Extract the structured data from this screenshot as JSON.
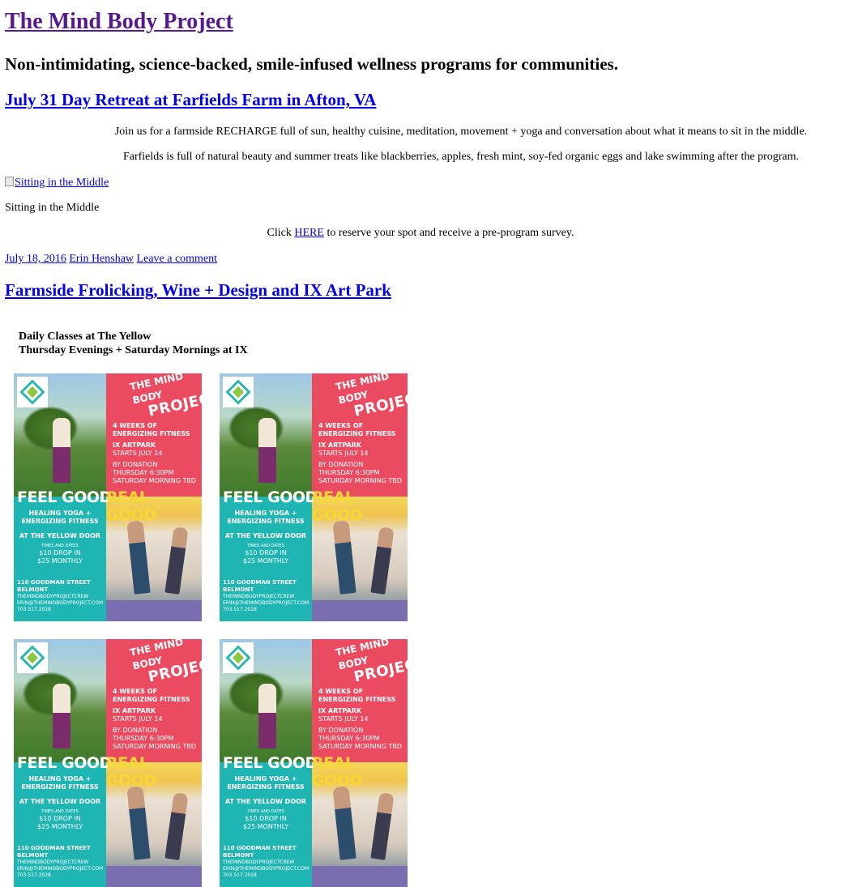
{
  "site": {
    "title": "The Mind Body Project",
    "tagline": "Non-intimidating, science-backed, smile-infused wellness programs for communities."
  },
  "post1": {
    "title": "July 31 Day Retreat at Farfields Farm in Afton, VA",
    "para1": "Join us for a farmside RECHARGE full of sun, healthy cuisine, meditation, movement + yoga and conversation about what it means to sit in the middle.",
    "para2": "Farfields is full of natural beauty and summer treats like blackberries, apples, fresh mint, soy-fed organic eggs and lake swimming after the program.",
    "image_alt": "Sitting in the Middle",
    "caption": "Sitting in the Middle",
    "click_prefix": "Click ",
    "click_link": "HERE",
    "click_suffix": " to reserve your spot and receive a pre-program survey.",
    "meta": {
      "date": "July 18, 2016",
      "author": "Erin Henshaw",
      "comment": "Leave a comment"
    }
  },
  "post2": {
    "title": "Farmside Frolicking, Wine + Design and IX Art Park",
    "classes_line1": "Daily Classes at The Yellow",
    "classes_line2": "Thursday Evenings + Saturday Mornings at IX"
  },
  "flyer": {
    "brand_small": "THE MIND BODY",
    "brand_big": "PROJECT",
    "weeks": "4 WEEKS OF",
    "fitness": "ENERGIZING FITNESS",
    "venue": "IX ARTPARK",
    "starts": "STARTS JULY 14",
    "donation": "BY DONATION",
    "thursday": "THURSDAY 6:30PM",
    "saturday": "SATURDAY MORNING TBD",
    "feel_good": "FEEL GOOD",
    "real_good": "REAL GOOD",
    "healing1": "HEALING YOGA +",
    "healing2": "ENERGIZING FITNESS",
    "yellow_door": "AT THE YELLOW DOOR",
    "times": "TIMES AND DATES",
    "drop_in": "$10 DROP IN",
    "monthly": "$25 MONTHLY",
    "street": "110 GOODMAN STREET",
    "city": "BELMONT",
    "social": "THEMINDBODYPROJECTCREW",
    "email": "ERIN@THEMINDBODYPROJECT.COM",
    "phone": "703.517.2028"
  },
  "colors": {
    "link": "#0000ee",
    "visited": "#551a8b",
    "flyer_red": "#ea4b60",
    "flyer_teal": "#1fb5b3",
    "flyer_yellow": "#f5d836"
  }
}
